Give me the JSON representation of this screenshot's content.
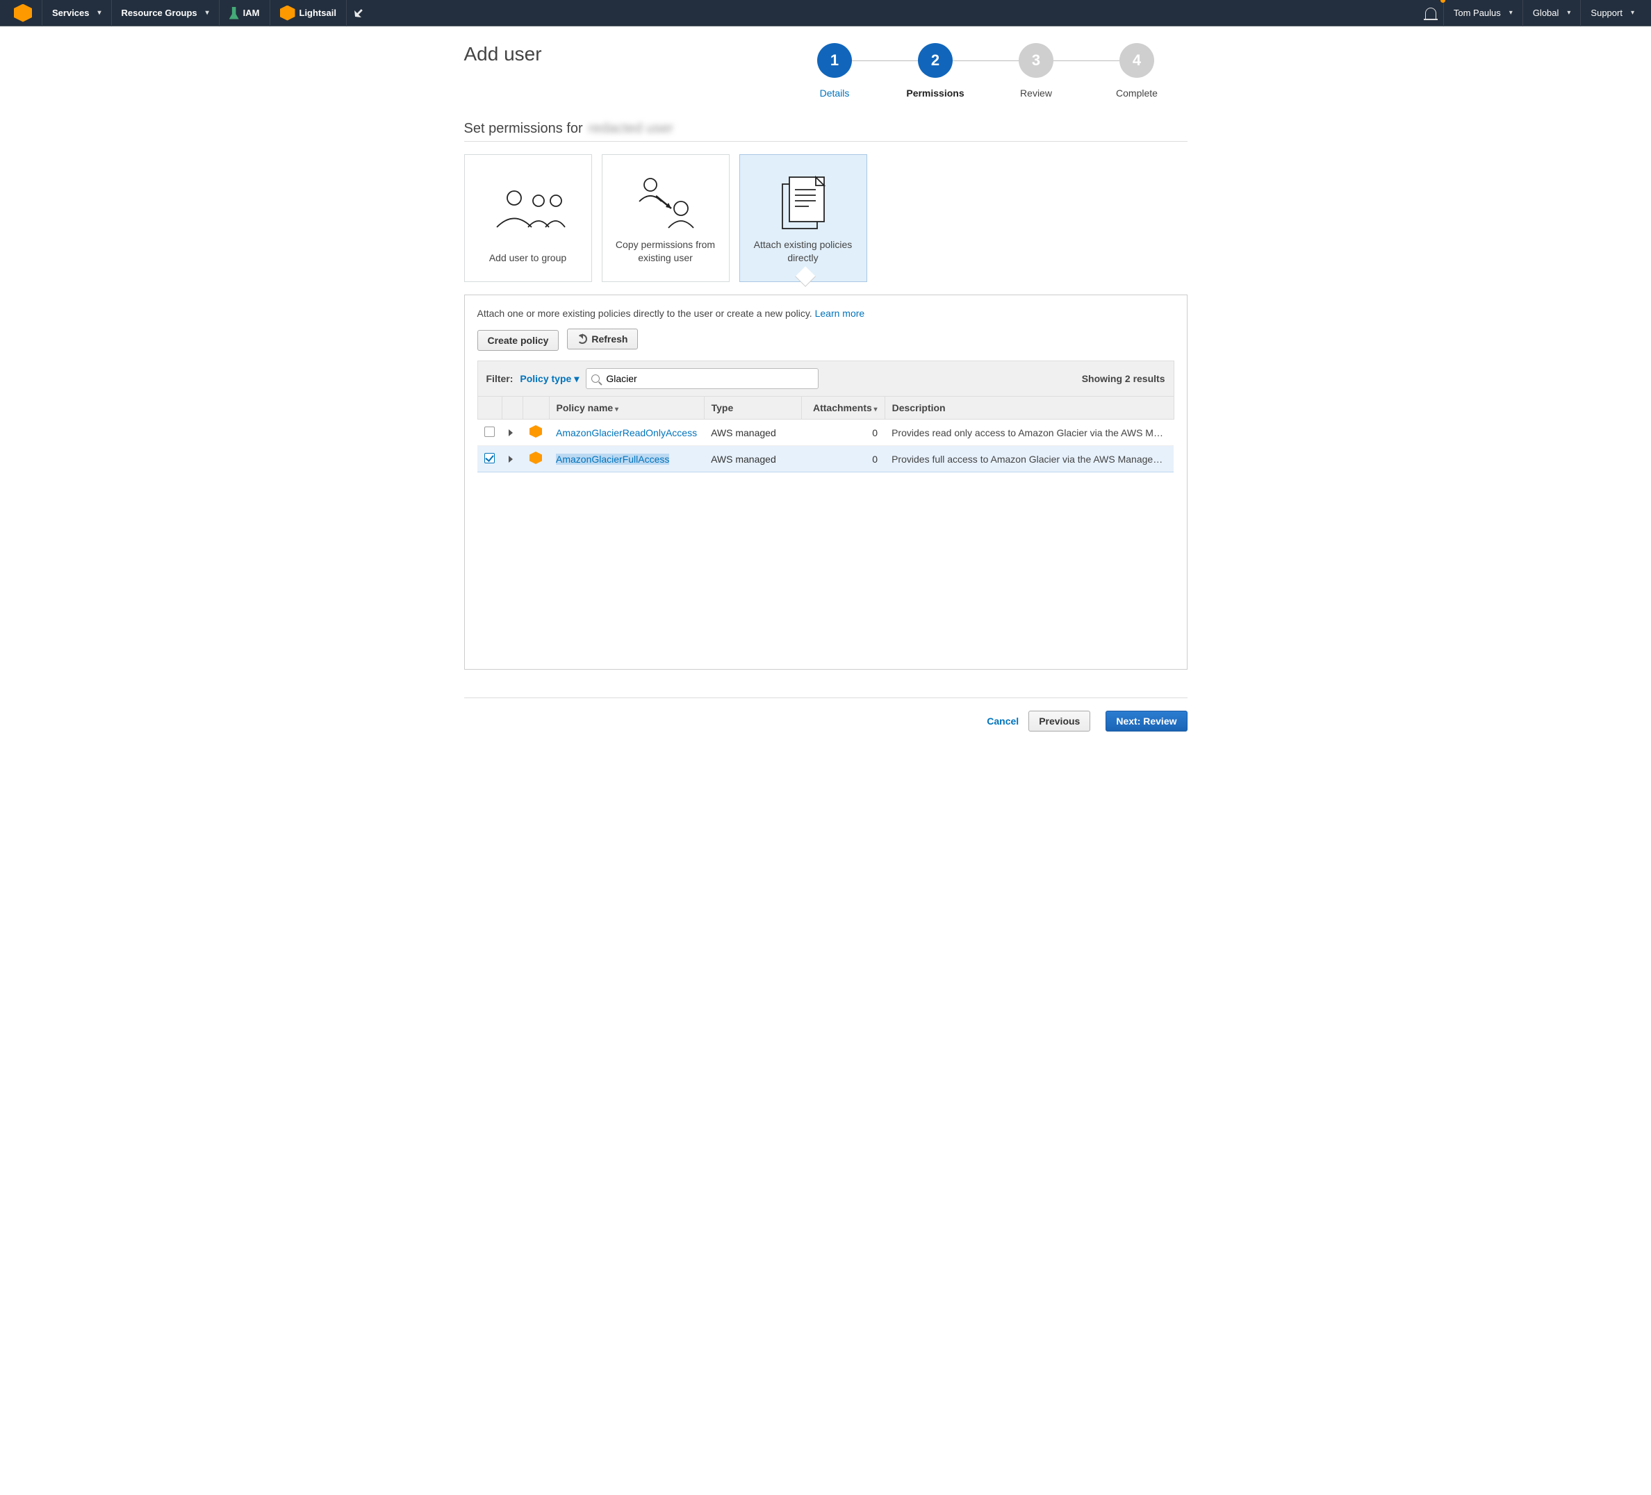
{
  "nav": {
    "services": "Services",
    "resource_groups": "Resource Groups",
    "iam": "IAM",
    "lightsail": "Lightsail",
    "user": "Tom Paulus",
    "region": "Global",
    "support": "Support"
  },
  "page": {
    "title": "Add user",
    "section_prefix": "Set permissions for",
    "section_user": "redacted user"
  },
  "wizard": {
    "steps": [
      {
        "num": "1",
        "label": "Details",
        "state": "done"
      },
      {
        "num": "2",
        "label": "Permissions",
        "state": "current"
      },
      {
        "num": "3",
        "label": "Review",
        "state": "todo"
      },
      {
        "num": "4",
        "label": "Complete",
        "state": "todo"
      }
    ]
  },
  "cards": {
    "add_group": "Add user to group",
    "copy": "Copy permissions from existing user",
    "attach": "Attach existing policies directly"
  },
  "panel": {
    "hint_text": "Attach one or more existing policies directly to the user or create a new policy. ",
    "learn_more": "Learn more",
    "create_policy": "Create policy",
    "refresh": "Refresh",
    "filter_label": "Filter:",
    "filter_dd": "Policy type",
    "search_value": "Glacier",
    "results": "Showing 2 results"
  },
  "table": {
    "headers": {
      "name": "Policy name",
      "type": "Type",
      "attach": "Attachments",
      "desc": "Description"
    },
    "rows": [
      {
        "checked": false,
        "name": "AmazonGlacierReadOnlyAccess",
        "type": "AWS managed",
        "attach": "0",
        "desc": "Provides read only access to Amazon Glacier via the AWS Ma…"
      },
      {
        "checked": true,
        "name": "AmazonGlacierFullAccess",
        "type": "AWS managed",
        "attach": "0",
        "desc": "Provides full access to Amazon Glacier via the AWS Managem…"
      }
    ]
  },
  "footer": {
    "cancel": "Cancel",
    "previous": "Previous",
    "next": "Next: Review"
  }
}
